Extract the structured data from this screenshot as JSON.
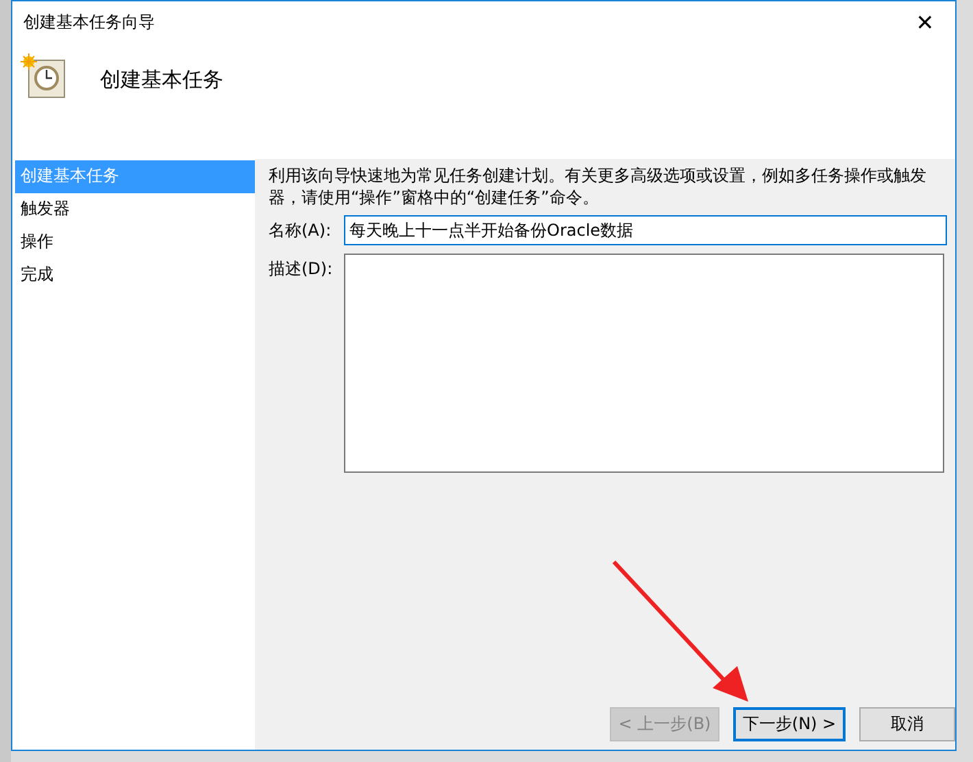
{
  "window": {
    "title": "创建基本任务向导",
    "close": "✕"
  },
  "header": {
    "title": "创建基本任务"
  },
  "steps": [
    {
      "label": "创建基本任务",
      "selected": true
    },
    {
      "label": "触发器",
      "selected": false
    },
    {
      "label": "操作",
      "selected": false
    },
    {
      "label": "完成",
      "selected": false
    }
  ],
  "intro": "利用该向导快速地为常见任务创建计划。有关更多高级选项或设置，例如多任务操作或触发器，请使用“操作”窗格中的“创建任务”命令。",
  "name_field": {
    "label": "名称(A):",
    "value": "每天晚上十一点半开始备份Oracle数据"
  },
  "description_field": {
    "label": "描述(D):"
  },
  "buttons": [
    {
      "label": "< 上一步(B)",
      "disabled": true,
      "default": false
    },
    {
      "label": "下一步(N) >",
      "disabled": false,
      "default": true
    },
    {
      "label": "取消",
      "disabled": false,
      "default": false
    }
  ]
}
